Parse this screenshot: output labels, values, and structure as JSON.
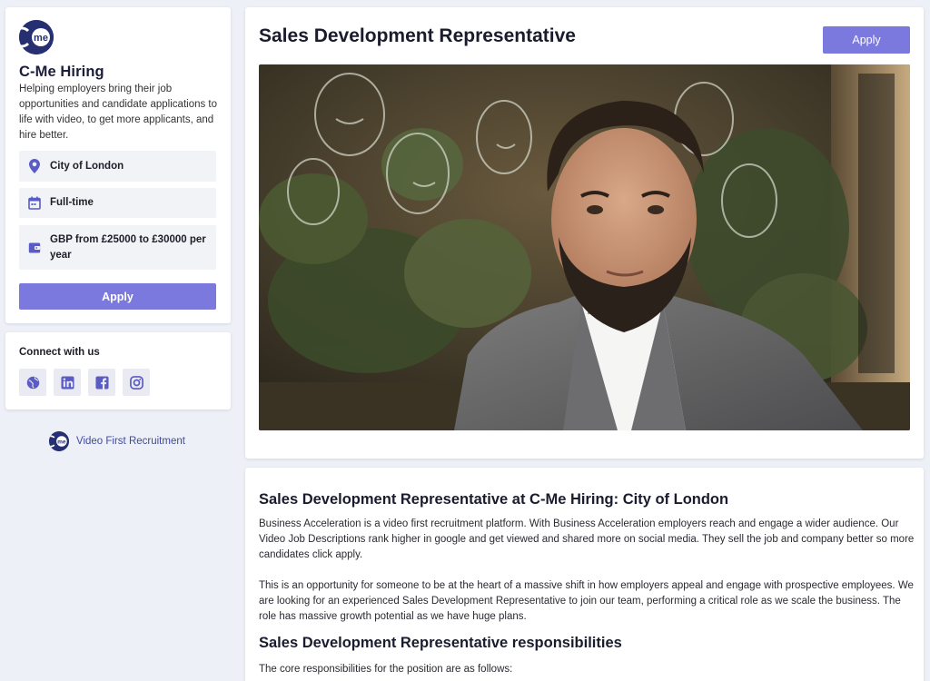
{
  "company": {
    "logo_text": "me",
    "name": "C-Me Hiring",
    "description": "Helping employers bring their job opportunities and candidate applications to life with video, to get more applicants, and hire better."
  },
  "details": {
    "location": "City of London",
    "job_type": "Full-time",
    "salary": "GBP from £25000 to £30000 per year"
  },
  "buttons": {
    "apply_label": "Apply"
  },
  "connect": {
    "title": "Connect with us",
    "icons": [
      "globe-icon",
      "linkedin-icon",
      "facebook-icon",
      "instagram-icon"
    ]
  },
  "footer": {
    "brand_text": "Video First Recruitment"
  },
  "job": {
    "title": "Sales Development Representative"
  },
  "description": {
    "heading": "Sales Development Representative at C-Me Hiring: City of London",
    "paragraph_1": "Business Acceleration is a video first recruitment platform. With Business Acceleration employers reach and engage a wider audience. Our Video Job Descriptions rank higher in google and get viewed and shared more on social media. They sell the job and company better so more candidates click apply.",
    "paragraph_2": "This is an opportunity for someone to be at the heart of a massive shift in how employers appeal and engage with prospective employees. We are looking for an experienced Sales Development Representative to join our team, performing a critical role as we scale the business. The role has massive growth potential as we have huge plans.",
    "responsibilities_heading": "Sales Development Representative responsibilities",
    "responsibilities_intro": "The core responsibilities for the position are as follows:"
  },
  "colors": {
    "accent": "#7b79de",
    "brand_navy": "#262f72",
    "link_blue": "#3e4aa0",
    "icon_purple": "#5a5bc4",
    "page_bg": "#eef0f7"
  }
}
